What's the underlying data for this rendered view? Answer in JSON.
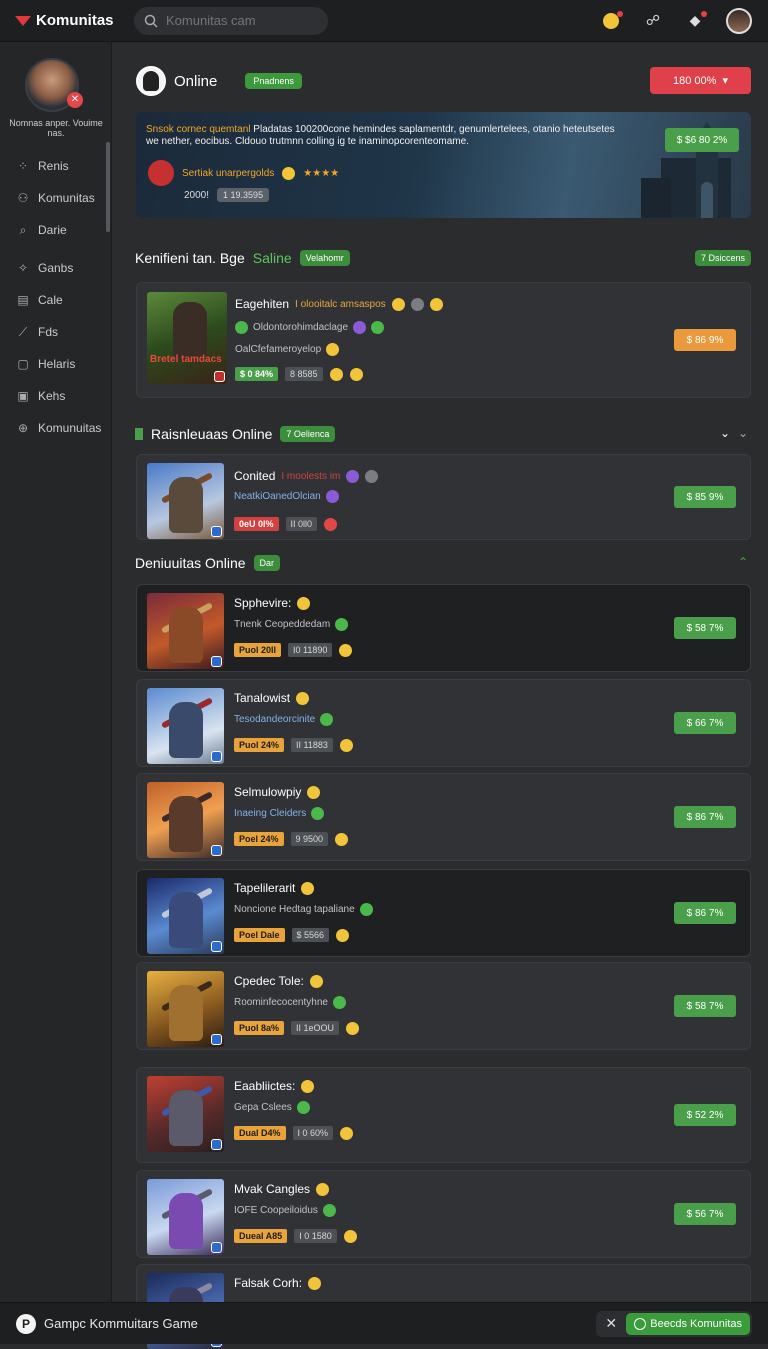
{
  "app": {
    "logo": "Komunitas"
  },
  "search": {
    "placeholder": "Komunitas cam"
  },
  "user": {
    "name": "Nomnas anper. Vouime nas."
  },
  "nav": [
    {
      "icon": "grid-icon",
      "glyph": "⁘",
      "label": "Renis"
    },
    {
      "icon": "people-icon",
      "glyph": "⚇",
      "label": "Komunitas"
    },
    {
      "icon": "search-icon",
      "glyph": "⌕",
      "label": "Darie"
    },
    {
      "icon": "controller-icon",
      "glyph": "✧",
      "label": "Ganbs"
    },
    {
      "icon": "document-icon",
      "glyph": "▤",
      "label": "Cale"
    },
    {
      "icon": "tag-icon",
      "glyph": "⟋",
      "label": "Fds"
    },
    {
      "icon": "square-icon",
      "glyph": "▢",
      "label": "Helaris"
    },
    {
      "icon": "image-icon",
      "glyph": "▣",
      "label": "Kehs"
    },
    {
      "icon": "globe-icon",
      "glyph": "⊕",
      "label": "Komunuitas"
    }
  ],
  "header": {
    "online_title": "Online",
    "online_pill": "Pnadnens",
    "red_button": "180 00% "
  },
  "banner": {
    "highlight": "Snsok cornec quemtanl",
    "text": "Pladatas 100200cone hemindes saplamentdr, genumlertelees, otanio heteutsetes we nether, eocibus. Cldouo trutmnn colling ig te inaminopcorenteomame.",
    "sub": "Sertiak unarpergolds",
    "stars": "★★★★",
    "row_label": "2000!",
    "row_tag": "1 19.3595",
    "button": "$ $6 80 2%"
  },
  "section1": {
    "title": "Kenifieni tan. Bge",
    "highlight": "Saline",
    "pill": "Velahomr",
    "right_pill": "7 Dsiccens"
  },
  "featured": {
    "title": "Eagehiten",
    "sub": "I olooitalc amsaspos",
    "line1": "Oldontorohimdaclage",
    "line2": "OalCfefameroyelop",
    "tag1": "$ 0 84%",
    "tag2": "8 8585",
    "button": "$ 86 9%",
    "art_label": "Bretel tamdacs"
  },
  "section2": {
    "title": "Raisnleuaas Online",
    "pill": "7 Oelienca"
  },
  "item2": {
    "title": "Conited",
    "sub": "I moolests im",
    "line": "NeatkiOanedOlcian",
    "tag1": "0eU 0l%",
    "tag2": "II 0ll0",
    "button": "$ 85 9%"
  },
  "section3": {
    "title": "Deniuuitas Online",
    "pill": "Dar"
  },
  "items": [
    {
      "title": "Spphevire:",
      "line": "Tnenk Ceopeddedam",
      "tag1": "Puol 20ll",
      "tag2": "I0 11890",
      "button": "$ 58 7%"
    },
    {
      "title": "Tanalowist",
      "line": "Tesodandeorcinite",
      "tag1": "Puol 24%",
      "tag2": "II 11883",
      "button": "$ 66 7%"
    },
    {
      "title": "Selmulowpiy",
      "line": "Inaeing Cleiders",
      "tag1": "Poel 24%",
      "tag2": "9 9500",
      "button": "$ 86 7%"
    },
    {
      "title": "Tapelilerarit",
      "line": "Noncione Hedtag tapaliane",
      "tag1": "Poel Dale",
      "tag2": "$ 5566",
      "button": "$ 86 7%"
    },
    {
      "title": "Cpedec Tole:",
      "line": "Roominfecocentyhne",
      "tag1": "Puol 8a%",
      "tag2": "II 1eOOU",
      "button": "$ 58 7%"
    },
    {
      "title": "Eaabliictes:",
      "line": "Gepa Cslees",
      "tag1": "Dual D4%",
      "tag2": "I 0 60%",
      "button": "$ 52 2%"
    },
    {
      "title": "Mvak Cangles",
      "line": "IOFE Coopeiloidus",
      "tag1": "Dueal A85",
      "tag2": "I 0 1580",
      "button": "$ 56 7%"
    },
    {
      "title": "Falsak Corh:",
      "line": "",
      "tag1": "",
      "tag2": "",
      "button": ""
    }
  ],
  "bottom": {
    "logo": "P",
    "title": "Gampc Kommuitars Game",
    "close": "✕",
    "cta": "Beecds Komunitas"
  }
}
